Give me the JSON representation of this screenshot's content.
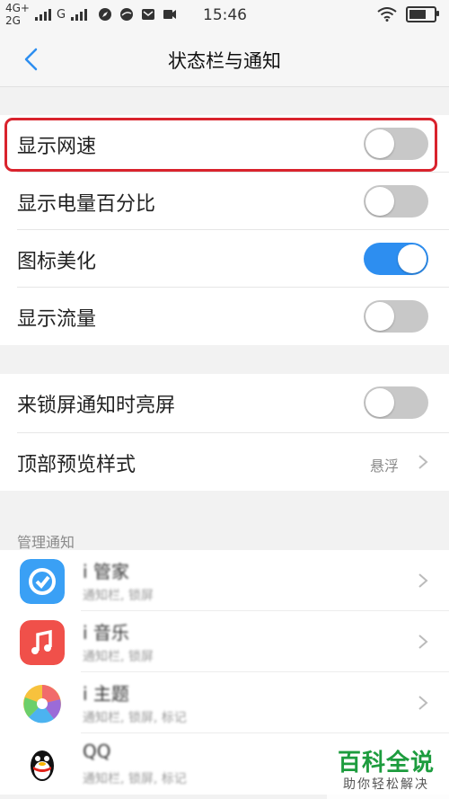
{
  "status_bar": {
    "network_top": "4G+",
    "network_bottom": "2G",
    "network_secondary": "G",
    "time": "15:46"
  },
  "header": {
    "title": "状态栏与通知"
  },
  "settings": [
    {
      "label": "显示网速",
      "on": false
    },
    {
      "label": "显示电量百分比",
      "on": false
    },
    {
      "label": "图标美化",
      "on": true
    },
    {
      "label": "显示流量",
      "on": false
    }
  ],
  "screen": {
    "wake_label": "来锁屏通知时亮屏",
    "wake_on": false,
    "preview_label": "顶部预览样式",
    "preview_value": "悬浮"
  },
  "manage": {
    "section_label": "管理通知",
    "apps": [
      {
        "name": "i 管家",
        "sub": "通知栏, 锁屏",
        "icon": "shield-app-icon"
      },
      {
        "name": "i 音乐",
        "sub": "通知栏, 锁屏",
        "icon": "music-app-icon"
      },
      {
        "name": "i 主题",
        "sub": "通知栏, 锁屏, 标记",
        "icon": "theme-app-icon"
      },
      {
        "name": "QQ",
        "sub": "通知栏, 锁屏, 标记",
        "icon": "qq-app-icon"
      }
    ]
  },
  "watermark": {
    "main": "百科全说",
    "sub": "助你轻松解决"
  },
  "colors": {
    "accent": "#2d8ef0",
    "highlight": "#d9232d",
    "toggle_off": "#c8c8c8"
  }
}
